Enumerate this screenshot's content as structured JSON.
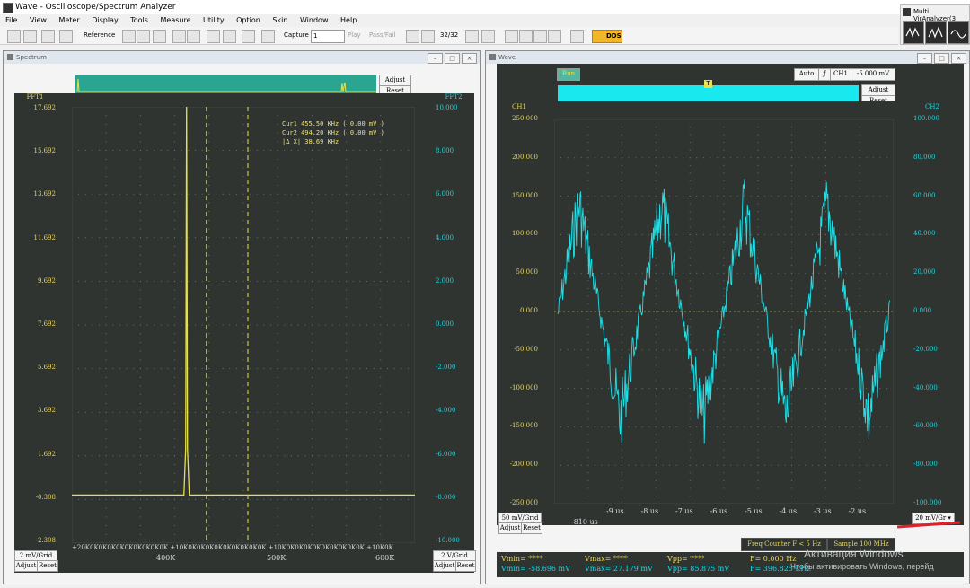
{
  "app": {
    "title": "Wave - Oscilloscope/Spectrum Analyzer"
  },
  "menu": [
    "File",
    "View",
    "Meter",
    "Display",
    "Tools",
    "Measure",
    "Utility",
    "Option",
    "Skin",
    "Window",
    "Help"
  ],
  "toolbar": {
    "reference": "Reference",
    "capture": "Capture",
    "capture_value": "1",
    "play": "Play",
    "passfail": "Pass/Fail",
    "frames": "32/32",
    "dds": "DDS"
  },
  "multivir": {
    "title": "Multi VirAnalyzer(3"
  },
  "spectrum": {
    "title": "Spectrum",
    "adjust": "Adjust",
    "reset": "Reset",
    "fft1": "FFT1",
    "fft2": "FFT2",
    "y_left": [
      "17.692",
      "15.692",
      "13.692",
      "11.692",
      "9.692",
      "7.692",
      "5.692",
      "3.692",
      "1.692",
      "-0.308",
      "-2.308"
    ],
    "y_right": [
      "10.000",
      "8.000",
      "6.000",
      "4.000",
      "2.000",
      "0.000",
      "-2.000",
      "-4.000",
      "-6.000",
      "-8.000",
      "-10.000"
    ],
    "cursor_labels": [
      "Cur1",
      "Cur2"
    ],
    "cursor_info": {
      "cur1": "Cur1   455.50 KHz ( 0.00 mV )",
      "cur2": "Cur2   494.20 KHz ( 0.00 mV )",
      "delta": "|Δ X|   38.69 KHz"
    },
    "x_scale_text": "+20K0K0K0K0K0K0K0K0K0K +10K0K0K0K0K0K0K0K0K0K +10K0K0K0K0K0K0K0K0K0K +10K0K",
    "x_major": [
      "400K",
      "500K",
      "600K"
    ],
    "grid_left": "2 mV/Grid",
    "grid_right": "2 V/Grid",
    "peak_freq_khz": 437,
    "noise_floor": -0.1
  },
  "wave": {
    "title": "Wave",
    "run": "Run",
    "auto": "Auto",
    "trig_ch": "CH1",
    "trig_level": "-5.000 mV",
    "adjust": "Adjust",
    "reset": "Reset",
    "ch1": "CH1",
    "ch2": "CH2",
    "y_left": [
      "250.000",
      "200.000",
      "150.000",
      "100.000",
      "50.000",
      "0.000",
      "-50.000",
      "-100.000",
      "-150.000",
      "-200.000",
      "-250.000"
    ],
    "y_right": [
      "100.000",
      "80.000",
      "60.000",
      "40.000",
      "20.000",
      "0.000",
      "-20.000",
      "-40.000",
      "-60.000",
      "-80.000",
      "-100.000"
    ],
    "x_labels": [
      "-9 us",
      "-8 us",
      "-7 us",
      "-6 us",
      "-5 us",
      "-4 us",
      "-3 us",
      "-2 us"
    ],
    "x_start": "-810 us",
    "grid_left": "50 mV/Grid",
    "grid_right": "20 mV/Gr",
    "freq_counter": "Freq Counter F < 5 Hz",
    "sample": "Sample 100 MHz",
    "meas": {
      "vmin_a": "Vmin= ****",
      "vmin_b": "Vmin= -58.696 mV",
      "vmax_a": "Vmax= ****",
      "vmax_b": "Vmax= 27.179 mV",
      "vpp_a": "Vpp= ****",
      "vpp_b": "Vpp= 85.875 mV",
      "f_a": "F= 0.000 Hz",
      "f_b": "F= 396.825 KHz"
    },
    "signal": {
      "amplitude_mv": 140,
      "period_us": 2.5,
      "noise_mv": 45
    }
  },
  "watermark": {
    "line1": "Активация Windows",
    "line2": "Чтобы активировать Windows, перейд"
  },
  "colors": {
    "trace_yellow": "#e8e04a",
    "trace_cyan": "#1ee0e8",
    "screen": "#2f3431",
    "grid": "#5a6e66",
    "red_mark": "#e0202a"
  }
}
